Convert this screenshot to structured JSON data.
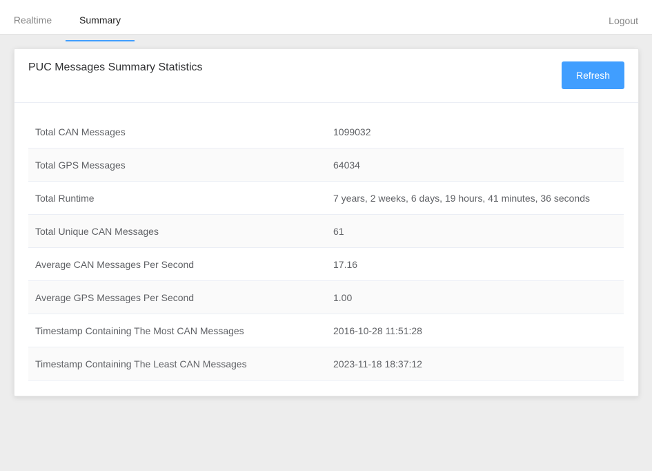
{
  "nav": {
    "tabs": [
      {
        "label": "Realtime"
      },
      {
        "label": "Summary"
      }
    ],
    "logout_label": "Logout"
  },
  "colors": {
    "accent": "#409eff",
    "background": "#ededed"
  },
  "card": {
    "title": "PUC Messages Summary Statistics",
    "refresh_label": "Refresh"
  },
  "stats": [
    {
      "label": "Total CAN Messages",
      "value": "1099032"
    },
    {
      "label": "Total GPS Messages",
      "value": "64034"
    },
    {
      "label": "Total Runtime",
      "value": "7 years, 2 weeks, 6 days, 19 hours, 41 minutes, 36 seconds"
    },
    {
      "label": "Total Unique CAN Messages",
      "value": "61"
    },
    {
      "label": "Average CAN Messages Per Second",
      "value": "17.16"
    },
    {
      "label": "Average GPS Messages Per Second",
      "value": "1.00"
    },
    {
      "label": "Timestamp Containing The Most CAN Messages",
      "value": "2016-10-28 11:51:28"
    },
    {
      "label": "Timestamp Containing The Least CAN Messages",
      "value": "2023-11-18 18:37:12"
    }
  ]
}
